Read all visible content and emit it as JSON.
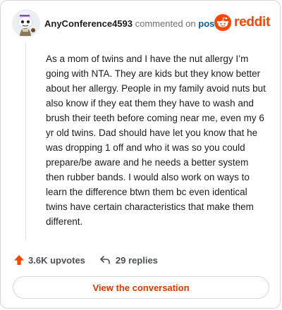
{
  "header": {
    "username": "AnyConference4593",
    "commented_text": "commented on",
    "post_link": "post",
    "brand": "reddit"
  },
  "comment": {
    "text": "As a mom of twins and I have the nut allergy I’m going with NTA. They are kids but they know better about her allergy. People in my family avoid nuts but also know if they eat them they have to wash and brush their teeth before coming near me, even my 6 yr old twins. Dad should have let you know that he was dropping 1 off and who it was so you could prepare/be aware and he needs a better system then rubber bands. I would also work on ways to learn the difference btwn them bc even identical twins have certain characteristics that make them different."
  },
  "actions": {
    "upvotes": "3.6K upvotes",
    "replies": "29 replies"
  },
  "footer": {
    "view_button": "View the conversation"
  },
  "icons": {
    "avatar": "snoo-avatar-icon",
    "brand": "reddit-logo-icon",
    "upvote": "upvote-arrow-icon",
    "reply": "reply-arrow-icon"
  },
  "colors": {
    "brand": "#ff4500",
    "link": "#0a5b9e",
    "button_text": "#d93a00",
    "border": "#d4d8db"
  }
}
